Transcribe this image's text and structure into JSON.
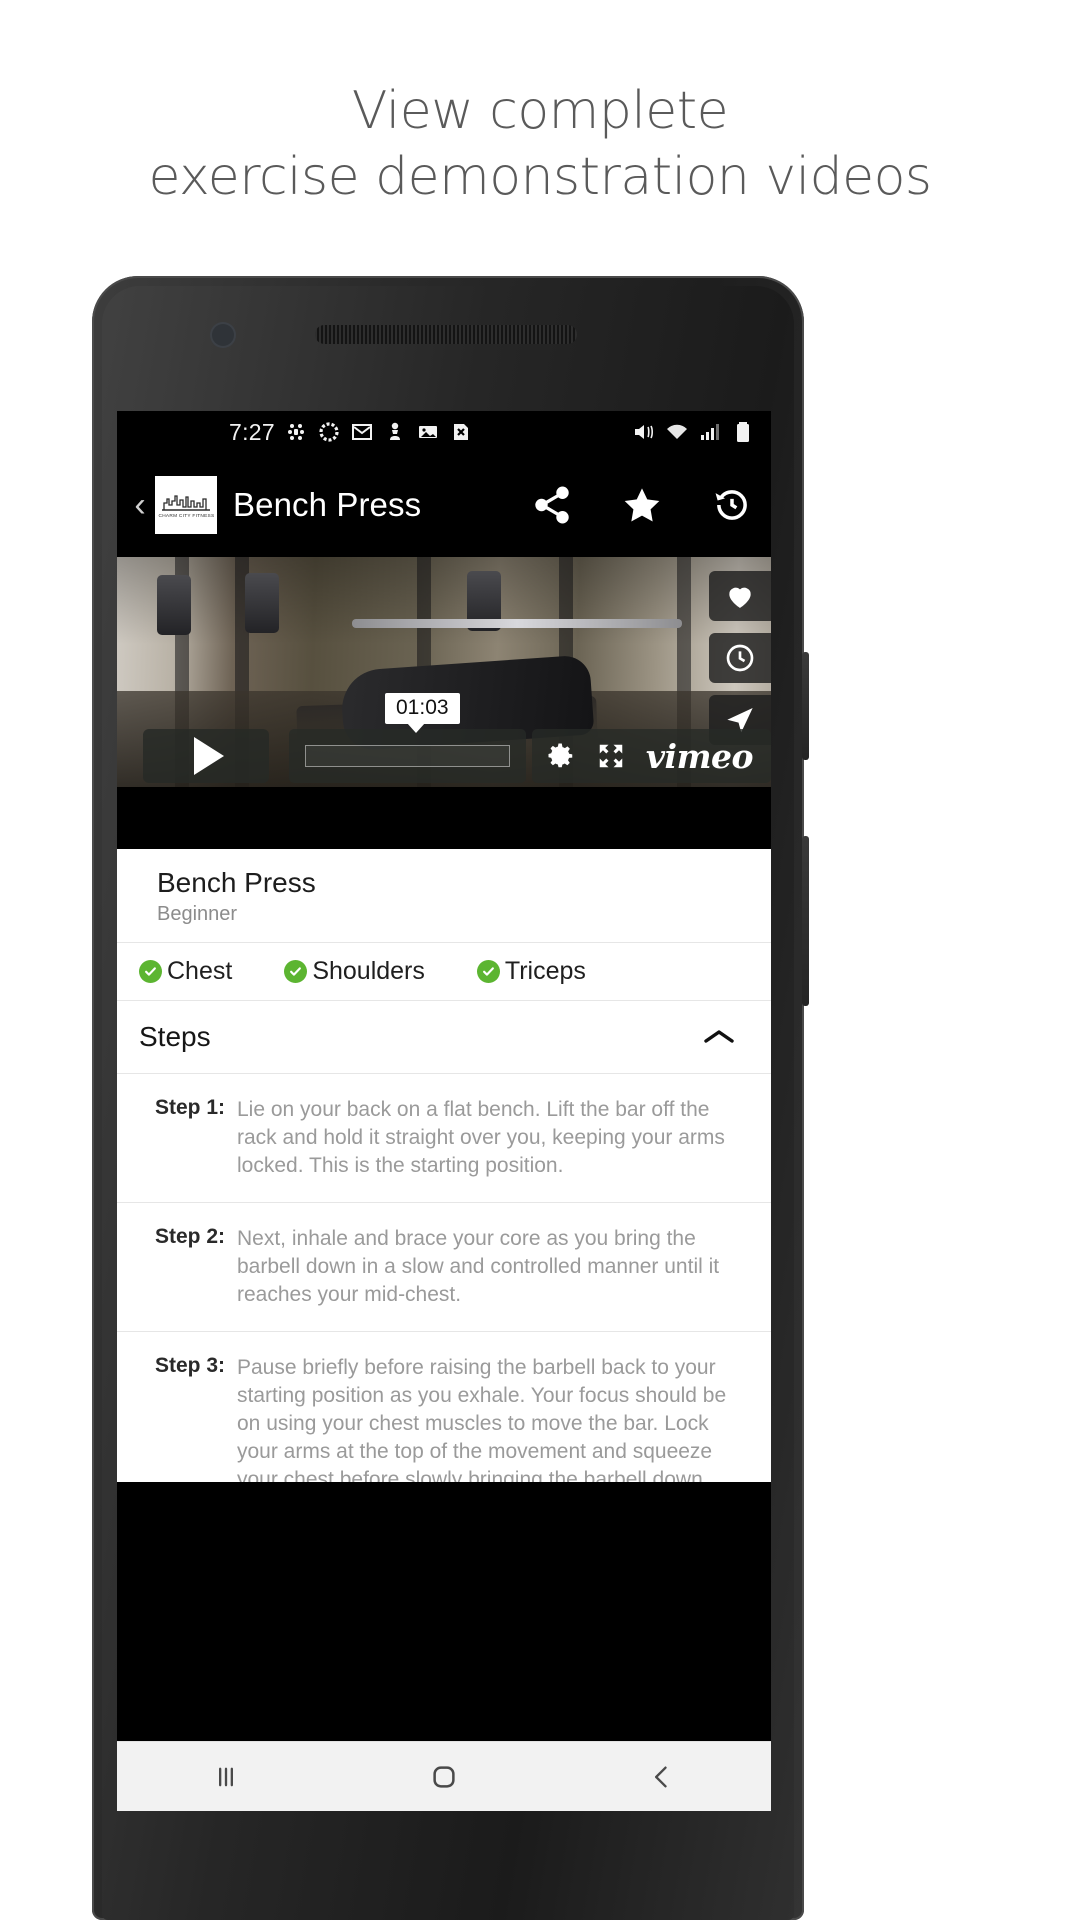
{
  "promo": {
    "line1": "View complete",
    "line2": "exercise demonstration videos"
  },
  "statusbar": {
    "time": "7:27",
    "left_icons": [
      "slack-icon",
      "loading-circle-icon",
      "gmail-icon",
      "chess-pawn-icon",
      "photos-icon",
      "x-file-icon"
    ],
    "right_icons": [
      "mute-icon",
      "wifi-icon",
      "cellular-signal-icon",
      "battery-icon"
    ]
  },
  "appbar": {
    "back_label": "‹",
    "logo_caption": "CHARM CITY FITNESS",
    "title": "Bench Press",
    "actions": [
      "share-icon",
      "star-icon",
      "history-icon"
    ]
  },
  "video": {
    "overlay_actions": [
      "heart-icon",
      "clock-icon",
      "send-icon"
    ],
    "play_label": "play-icon",
    "time_tooltip": "01:03",
    "settings_label": "gear-icon",
    "fullscreen_label": "fullscreen-icon",
    "brand": "vimeo"
  },
  "exercise": {
    "name": "Bench Press",
    "level": "Beginner",
    "muscles": [
      {
        "label": "Chest"
      },
      {
        "label": "Shoulders"
      },
      {
        "label": "Triceps"
      }
    ]
  },
  "steps_section": {
    "title": "Steps",
    "collapsed": false,
    "items": [
      {
        "label": "Step 1:",
        "text": "Lie on your back on a flat bench. Lift the bar off the rack and hold it straight over you, keeping your arms locked. This is the starting position."
      },
      {
        "label": "Step 2:",
        "text": "Next, inhale and brace your core as you bring the barbell down in a slow and controlled manner until it reaches your mid-chest."
      },
      {
        "label": "Step 3:",
        "text": "Pause briefly before raising the barbell back to your starting position as you exhale. Your focus should be on using your chest muscles to move the bar. Lock your arms at the top of the movement and squeeze your chest before slowly bringing the barbell down again. This step should take twice as long raising the weight to get the maximum benefit."
      }
    ]
  },
  "navbar": {
    "recents_label": "recents-icon",
    "home_label": "home-icon",
    "back_label": "back-icon"
  },
  "colors": {
    "accent_green": "#5cb531",
    "heading_gray": "#5a5a5a",
    "body_gray": "#9a9a9a"
  }
}
